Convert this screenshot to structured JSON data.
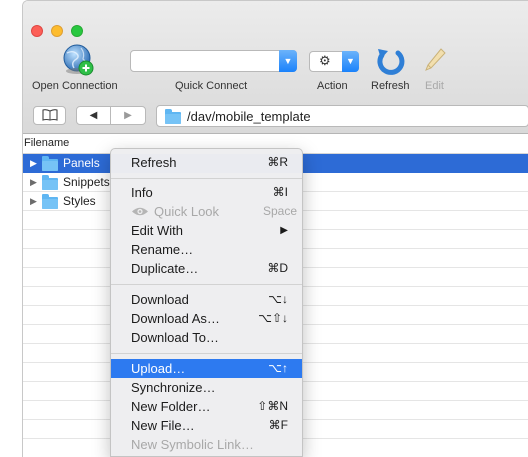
{
  "toolbar": {
    "open_connection": "Open Connection",
    "quick_connect": "Quick Connect",
    "action": "Action",
    "refresh": "Refresh",
    "edit": "Edit"
  },
  "path": "/dav/mobile_template",
  "column_header": "Filename",
  "files": [
    {
      "name": "Panels",
      "selected": true
    },
    {
      "name": "Snippets",
      "selected": false
    },
    {
      "name": "Styles",
      "selected": false
    }
  ],
  "menu": {
    "refresh": {
      "label": "Refresh",
      "shortcut": "⌘R"
    },
    "info": {
      "label": "Info",
      "shortcut": "⌘I"
    },
    "quick_look": {
      "label": "Quick Look",
      "shortcut": "Space"
    },
    "edit_with": {
      "label": "Edit With",
      "shortcut": "▶"
    },
    "rename": {
      "label": "Rename…"
    },
    "duplicate": {
      "label": "Duplicate…",
      "shortcut": "⌘D"
    },
    "download": {
      "label": "Download",
      "shortcut": "⌥↓"
    },
    "download_as": {
      "label": "Download As…",
      "shortcut": "⌥⇧↓"
    },
    "download_to": {
      "label": "Download To…"
    },
    "upload": {
      "label": "Upload…",
      "shortcut": "⌥↑"
    },
    "synchronize": {
      "label": "Synchronize…"
    },
    "new_folder": {
      "label": "New Folder…",
      "shortcut": "⇧⌘N"
    },
    "new_file": {
      "label": "New File…",
      "shortcut": "⌘F"
    },
    "new_symlink": {
      "label": "New Symbolic Link…"
    }
  },
  "colors": {
    "selection": "#2d6bd6",
    "menu_highlight": "#2d7af0",
    "accent_blue": "#1a82fb",
    "folder": "#5fb6f2"
  },
  "icons": {
    "open_connection": "globe-plus-icon",
    "action": "gear-icon",
    "refresh": "refresh-arrow-icon",
    "edit": "pencil-icon",
    "bookmarks": "book-icon",
    "back": "back-arrow-icon",
    "forward": "forward-arrow-icon",
    "folder": "folder-icon"
  }
}
